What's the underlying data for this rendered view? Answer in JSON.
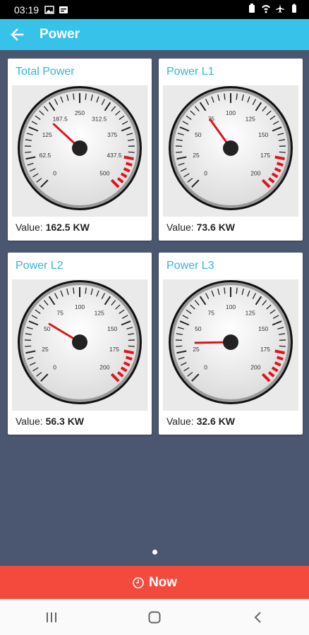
{
  "status_bar": {
    "time": "03:19"
  },
  "app_bar": {
    "title": "Power"
  },
  "gauges": [
    {
      "title": "Total Power",
      "value_label": "Value:",
      "value": "162.5 KW",
      "reading": 162.5,
      "max": 500,
      "ticks": [
        "0",
        "62.5",
        "125",
        "187.5",
        "250",
        "312.5",
        "375",
        "437.5",
        "500"
      ]
    },
    {
      "title": "Power L1",
      "value_label": "Value:",
      "value": "73.6 KW",
      "reading": 73.6,
      "max": 200,
      "ticks": [
        "0",
        "25",
        "50",
        "75",
        "100",
        "125",
        "150",
        "175",
        "200"
      ]
    },
    {
      "title": "Power L2",
      "value_label": "Value:",
      "value": "56.3 KW",
      "reading": 56.3,
      "max": 200,
      "ticks": [
        "0",
        "25",
        "50",
        "75",
        "100",
        "125",
        "150",
        "175",
        "200"
      ]
    },
    {
      "title": "Power L3",
      "value_label": "Value:",
      "value": "32.6 KW",
      "reading": 32.6,
      "max": 200,
      "ticks": [
        "0",
        "25",
        "50",
        "75",
        "100",
        "125",
        "150",
        "175",
        "200"
      ]
    }
  ],
  "now_button": {
    "label": "Now"
  },
  "colors": {
    "app_bar": "#37c3e9",
    "background": "#4b5670",
    "now_bar": "#f44a3e",
    "needle": "#e0141d",
    "title_text": "#35b4d9"
  },
  "icons": {
    "back": "arrow-left-icon",
    "clock": "clock-icon",
    "recents": "recents-icon",
    "home": "home-icon",
    "back_nav": "chevron-left-icon"
  }
}
